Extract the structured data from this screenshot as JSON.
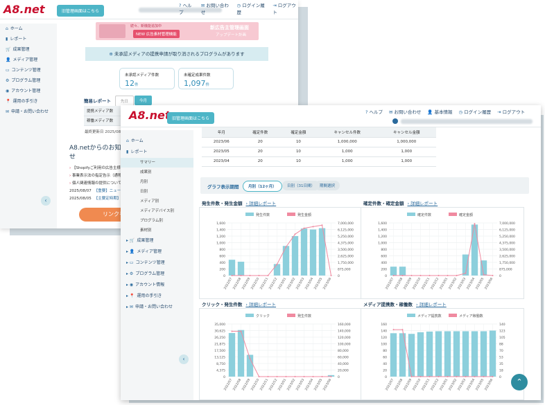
{
  "colors": {
    "brand_red": "#c8102e",
    "accent": "#4db5c7",
    "bar": "#8ccfdc",
    "line": "#f08aa0"
  },
  "back_window": {
    "logo": "A8.net",
    "old_screen_button": "旧管理画面はこちら",
    "nav": [
      {
        "icon": "?",
        "label": "ヘルプ"
      },
      {
        "icon": "✉",
        "label": "お問い合わせ"
      },
      {
        "icon": "◷",
        "label": "ログイン履歴"
      },
      {
        "icon": "⇥",
        "label": "ログアウト"
      }
    ],
    "sidebar": [
      {
        "icon": "⌂",
        "label": "ホーム"
      },
      {
        "icon": "▮",
        "label": "レポート"
      },
      {
        "icon": "🛒",
        "label": "成果管理"
      },
      {
        "icon": "👤",
        "label": "メディア管理"
      },
      {
        "icon": "▭",
        "label": "コンテンツ管理"
      },
      {
        "icon": "⚙",
        "label": "プログラム管理"
      },
      {
        "icon": "◉",
        "label": "アカウント管理"
      },
      {
        "icon": "📍",
        "label": "運用の手引き"
      },
      {
        "icon": "✉",
        "label": "申請・お問い合わせ"
      }
    ],
    "banner": {
      "line1": "続々、新機能追加中",
      "badge": "NEW 広告素材管理機能",
      "title": "新広告主管理画面",
      "sub": "アップデート計画"
    },
    "notice": "未承認メディアの提携申請が取り消されるプログラムがあります",
    "cards": [
      {
        "label": "未承認メディア件数",
        "value": "12",
        "unit": "件"
      },
      {
        "label": "未確定成果件数",
        "value": "1,097",
        "unit": "件"
      }
    ],
    "simple_report": {
      "title": "簡易レポート",
      "prev": "先日",
      "today": "今月",
      "rows": [
        "提携メディア数",
        "稼働メディア数"
      ],
      "updated": "最終更新日 2025/08/18"
    },
    "news": {
      "title": "A8.netからのお知らせ",
      "items": [
        "【Shopifyご利用の広告主様】【重",
        "事業表示法の指定告示（通称ステ",
        "個人関連情報の提供について"
      ],
      "dated": [
        {
          "date": "2025/08/07",
          "text": "【重要】ニュース"
        },
        {
          "date": "2025/08/05",
          "text": "【主要定時期】"
        }
      ]
    },
    "link_button": "リンクを"
  },
  "front_window": {
    "logo": "A8.net",
    "old_screen_button": "旧管理画面はこちら",
    "nav": [
      {
        "icon": "?",
        "label": "ヘルプ"
      },
      {
        "icon": "✉",
        "label": "お問い合わせ"
      },
      {
        "icon": "👤",
        "label": "基本情報"
      },
      {
        "icon": "◷",
        "label": "ログイン履歴"
      },
      {
        "icon": "⇥",
        "label": "ログアウト"
      }
    ],
    "sidebar_top": [
      {
        "icon": "⌂",
        "label": "ホーム"
      },
      {
        "icon": "▮",
        "label": "レポート"
      }
    ],
    "report_subs": [
      "サマリー",
      "成果別",
      "月別",
      "日別",
      "メディア別",
      "メディアデバイス別",
      "プログラム別",
      "素材別"
    ],
    "sidebar_bottom": [
      {
        "icon": "🛒",
        "label": "成果管理"
      },
      {
        "icon": "👤",
        "label": "メディア管理"
      },
      {
        "icon": "▭",
        "label": "コンテンツ管理"
      },
      {
        "icon": "⚙",
        "label": "プログラム管理"
      },
      {
        "icon": "◉",
        "label": "アカウント情報"
      },
      {
        "icon": "📍",
        "label": "運用の手引き"
      },
      {
        "icon": "✉",
        "label": "申請・お問い合わせ"
      }
    ],
    "table": {
      "headers": [
        "年月",
        "確定件数",
        "確定金額",
        "キャンセル件数",
        "キャンセル金額"
      ],
      "rows": [
        [
          "2023/06",
          "20",
          "10",
          "1,000,000",
          "1,000,000"
        ],
        [
          "2023/05",
          "20",
          "10",
          "1,000",
          "1,000"
        ],
        [
          "2023/04",
          "20",
          "10",
          "1,000",
          "1,000"
        ]
      ]
    },
    "period": {
      "label": "グラフ表示期間",
      "options": [
        "月別（12ヶ月）",
        "日別（31日間）",
        "期間選択"
      ]
    },
    "detail_link": "詳細レポート"
  },
  "chart_data": [
    {
      "type": "bar",
      "title": "発生件数・発生金額",
      "categories": [
        "2022/07",
        "2022/08",
        "2022/09",
        "2022/10",
        "2022/11",
        "2022/12",
        "2023/01",
        "2023/02",
        "2023/03",
        "2023/04",
        "2023/05",
        "2023/06"
      ],
      "series": [
        {
          "name": "発生件数",
          "type": "bar",
          "axis": "left",
          "values": [
            480,
            420,
            0,
            0,
            0,
            350,
            900,
            1200,
            1430,
            1400,
            1440,
            0
          ]
        },
        {
          "name": "発生金額",
          "type": "line",
          "axis": "right",
          "values": [
            0,
            0,
            0,
            0,
            0,
            1500000,
            3800000,
            5500000,
            6300000,
            6500000,
            6700000,
            0
          ]
        }
      ],
      "ylim_left": [
        0,
        1600
      ],
      "ylim_right": [
        0,
        7000000
      ]
    },
    {
      "type": "bar",
      "title": "確定件数・確定金額",
      "categories": [
        "2022/07",
        "2022/08",
        "2022/09",
        "2022/10",
        "2022/11",
        "2022/12",
        "2023/01",
        "2023/02",
        "2023/03",
        "2023/04",
        "2023/05",
        "2023/06"
      ],
      "series": [
        {
          "name": "確定件数",
          "type": "bar",
          "axis": "left",
          "values": [
            270,
            270,
            0,
            0,
            0,
            0,
            0,
            0,
            640,
            1550,
            460,
            0
          ]
        },
        {
          "name": "確定金額",
          "type": "line",
          "axis": "right",
          "values": [
            0,
            0,
            0,
            0,
            0,
            0,
            0,
            0,
            300000,
            6900000,
            100000,
            0
          ]
        }
      ],
      "ylim_left": [
        0,
        1600
      ],
      "ylim_right": [
        0,
        7000000
      ]
    },
    {
      "type": "bar",
      "title": "クリック・発生件数",
      "categories": [
        "2022/07",
        "2022/08",
        "2022/09",
        "2022/10",
        "2022/11",
        "2022/12",
        "2023/01",
        "2023/02",
        "2023/03",
        "2023/04",
        "2023/05",
        "2023/06"
      ],
      "series": [
        {
          "name": "クリック",
          "type": "bar",
          "axis": "left",
          "values": [
            29000,
            31000,
            14500,
            0,
            0,
            0,
            0,
            0,
            0,
            0,
            0,
            1000
          ]
        },
        {
          "name": "発生件数",
          "type": "line",
          "axis": "right",
          "values": [
            138000,
            138000,
            55000,
            0,
            0,
            0,
            0,
            0,
            0,
            0,
            0,
            0
          ]
        }
      ],
      "ylim_left": [
        0,
        35000
      ],
      "ylim_right": [
        0,
        160000
      ]
    },
    {
      "type": "bar",
      "title": "メディア提携数・稼働数",
      "categories": [
        "2022/07",
        "2022/08",
        "2022/09",
        "2022/10",
        "2022/11",
        "2022/12",
        "2023/01",
        "2023/02",
        "2023/03",
        "2023/04",
        "2023/05",
        "2023/06"
      ],
      "series": [
        {
          "name": "メディア提携数",
          "type": "bar",
          "axis": "left",
          "values": [
            132,
            132,
            130,
            135,
            137,
            138,
            138,
            138,
            138,
            138,
            138,
            140
          ]
        },
        {
          "name": "メディア稼働数",
          "type": "line",
          "axis": "right",
          "values": [
            125,
            125,
            0,
            0,
            0,
            0,
            0,
            0,
            0,
            0,
            0,
            0
          ]
        }
      ],
      "ylim_left": [
        0,
        160
      ],
      "ylim_right": [
        0,
        140
      ]
    }
  ]
}
